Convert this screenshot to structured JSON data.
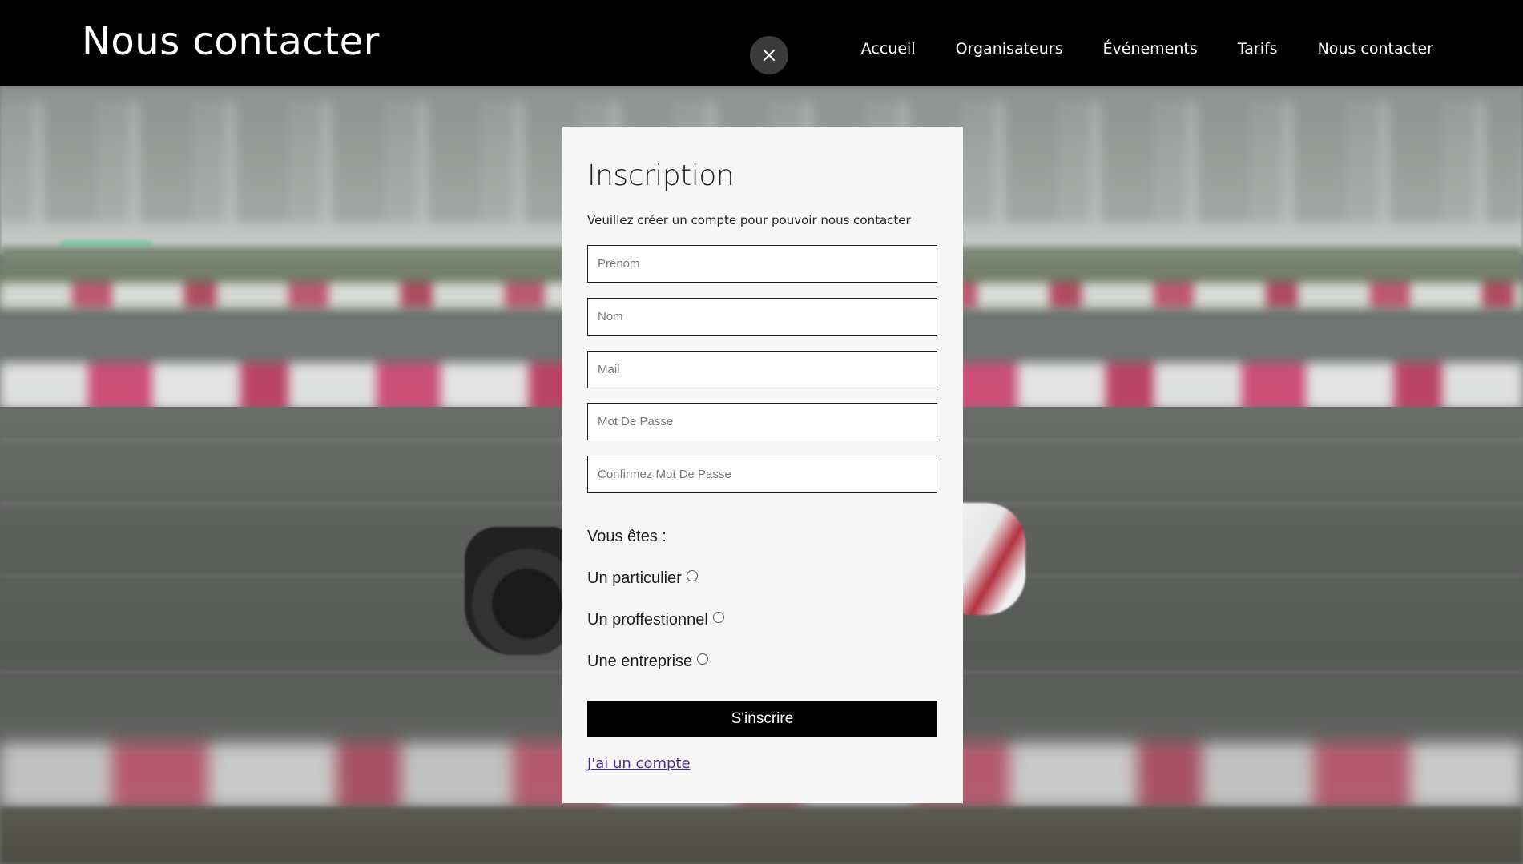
{
  "header": {
    "title": "Nous contacter",
    "close_icon": "close-icon",
    "nav": [
      "Accueil",
      "Organisateurs",
      "Événements",
      "Tarifs",
      "Nous contacter"
    ]
  },
  "modal": {
    "title": "Inscription",
    "subtitle": "Veuillez créer un compte pour pouvoir nous contacter",
    "fields": {
      "first_name_placeholder": "Prénom",
      "last_name_placeholder": "Nom",
      "email_placeholder": "Mail",
      "password_placeholder": "Mot De Passe",
      "confirm_password_placeholder": "Confirmez Mot De Passe"
    },
    "question": "Vous êtes :",
    "options": [
      "Un particulier",
      "Un proffestionnel",
      "Une entreprise"
    ],
    "submit_label": "S'inscrire",
    "login_link": "J'ai un compte"
  },
  "colors": {
    "header_bg": "#000000",
    "modal_bg": "#f7f7f7",
    "button_bg": "#000000",
    "link": "#4b2c8e"
  }
}
